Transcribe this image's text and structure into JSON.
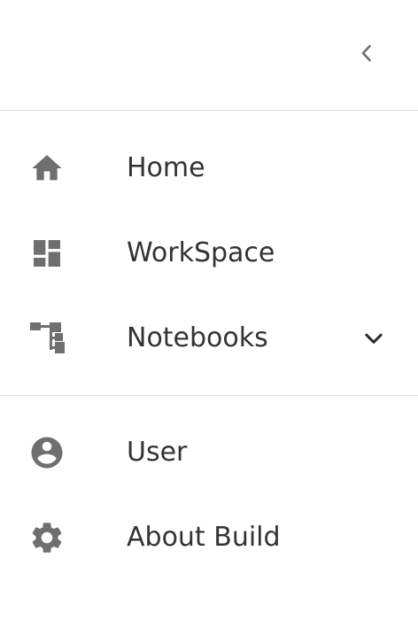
{
  "sidebar": {
    "collapse_icon": "chevron-left-icon",
    "primary_items": [
      {
        "label": "Home",
        "icon": "home-icon"
      },
      {
        "label": "WorkSpace",
        "icon": "dashboard-icon"
      },
      {
        "label": "Notebooks",
        "icon": "tree-structure-icon",
        "expand_icon": "chevron-down-icon"
      }
    ],
    "secondary_items": [
      {
        "label": "User",
        "icon": "account-circle-icon"
      },
      {
        "label": "About Build",
        "icon": "gear-icon"
      }
    ]
  },
  "colors": {
    "icon": "#6f6f6f",
    "text": "#333333",
    "divider": "#e0e0e0",
    "background": "#ffffff"
  }
}
